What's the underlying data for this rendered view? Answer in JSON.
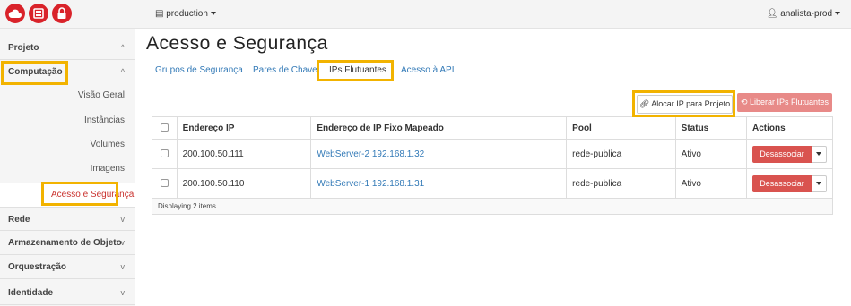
{
  "topbar": {
    "project_label": "production",
    "user_label": "analista-prod"
  },
  "sidebar": {
    "groups": [
      {
        "label": "Projeto",
        "chevron": "^"
      },
      {
        "label": "Computação",
        "chevron": "^"
      },
      {
        "label": "Rede",
        "chevron": "v"
      },
      {
        "label": "Armazenamento de Objeto",
        "chevron": "v"
      },
      {
        "label": "Orquestração",
        "chevron": "v"
      },
      {
        "label": "Identidade",
        "chevron": "v"
      }
    ],
    "items": [
      {
        "label": "Visão Geral"
      },
      {
        "label": "Instâncias"
      },
      {
        "label": "Volumes"
      },
      {
        "label": "Imagens"
      },
      {
        "label": "Acesso e Segurança"
      }
    ]
  },
  "main": {
    "title": "Acesso e Segurança",
    "tabs": [
      {
        "label": "Grupos de Segurança"
      },
      {
        "label": "Pares de Chave"
      },
      {
        "label": "IPs Flutuantes"
      },
      {
        "label": "Acesso à API"
      }
    ],
    "alloc_button": "Alocar IP para Projeto",
    "release_button": "Liberar IPs Flutuantes",
    "table": {
      "headers": [
        "Endereço IP",
        "Endereço de IP Fixo Mapeado",
        "Pool",
        "Status",
        "Actions"
      ],
      "rows": [
        {
          "ip": "200.100.50.111",
          "mapped": "WebServer-2 192.168.1.32",
          "pool": "rede-publica",
          "status": "Ativo",
          "action": "Desassociar"
        },
        {
          "ip": "200.100.50.110",
          "mapped": "WebServer-1 192.168.1.31",
          "pool": "rede-publica",
          "status": "Ativo",
          "action": "Desassociar"
        }
      ],
      "footer": "Displaying 2 items"
    }
  },
  "colors": {
    "highlight": "#f2b300",
    "danger": "#d9534f",
    "link": "#337ab7",
    "logo": "#d9232a"
  }
}
